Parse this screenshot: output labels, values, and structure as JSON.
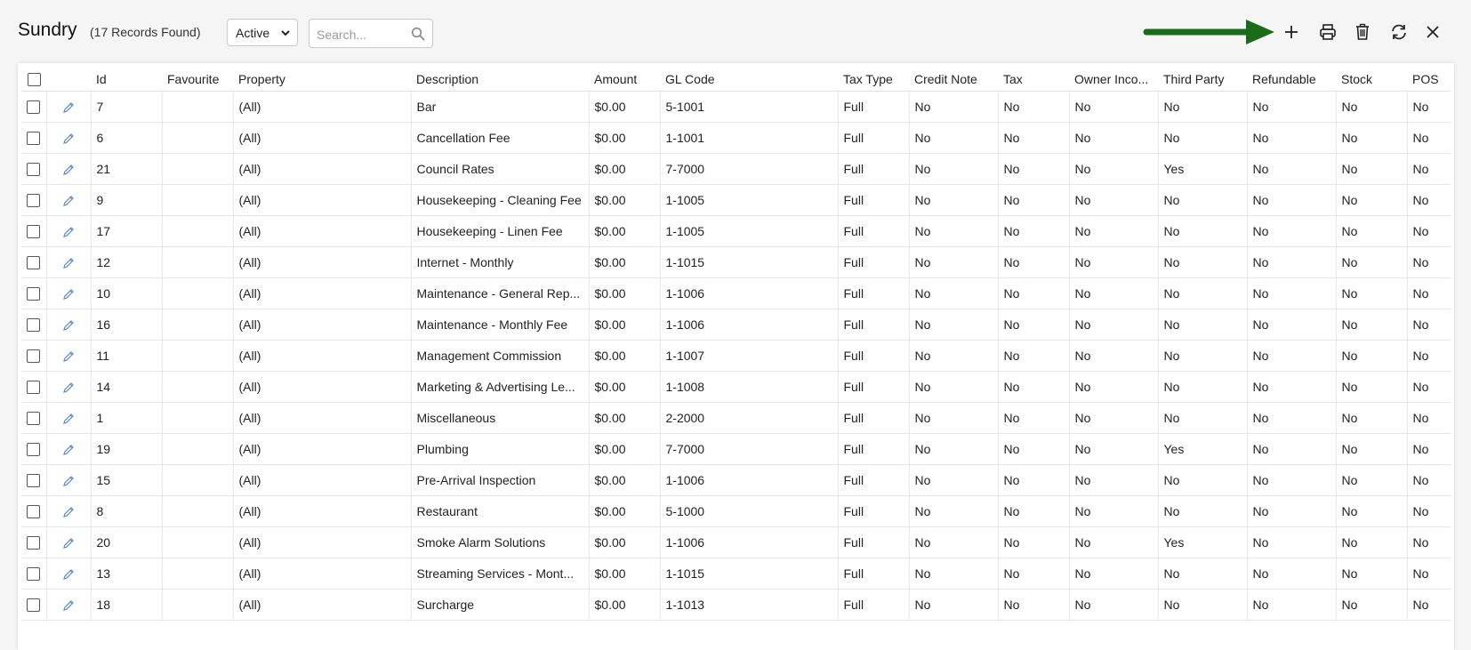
{
  "header": {
    "title": "Sundry",
    "record_count": "(17 Records Found)",
    "status_filter": "Active",
    "search_placeholder": "Search..."
  },
  "toolbar": {
    "add_icon": "plus-icon",
    "print_icon": "printer-icon",
    "delete_icon": "trash-icon",
    "refresh_icon": "refresh-icon",
    "close_icon": "close-icon",
    "arrow_color": "#1a6b1a"
  },
  "table": {
    "columns": [
      "",
      "",
      "Id",
      "Favourite",
      "Property",
      "Description",
      "Amount",
      "GL Code",
      "Tax Type",
      "Credit Note",
      "Tax",
      "Owner Inco...",
      "Third Party",
      "Refundable",
      "Stock",
      "POS"
    ],
    "rows": [
      {
        "id": "7",
        "favourite": "",
        "property": "(All)",
        "description": "Bar",
        "amount": "$0.00",
        "gl_code": "5-1001",
        "tax_type": "Full",
        "credit_note": "No",
        "tax": "No",
        "owner_income": "No",
        "third_party": "No",
        "refundable": "No",
        "stock": "No",
        "pos": "No"
      },
      {
        "id": "6",
        "favourite": "",
        "property": "(All)",
        "description": "Cancellation Fee",
        "amount": "$0.00",
        "gl_code": "1-1001",
        "tax_type": "Full",
        "credit_note": "No",
        "tax": "No",
        "owner_income": "No",
        "third_party": "No",
        "refundable": "No",
        "stock": "No",
        "pos": "No"
      },
      {
        "id": "21",
        "favourite": "",
        "property": "(All)",
        "description": "Council Rates",
        "amount": "$0.00",
        "gl_code": "7-7000",
        "tax_type": "Full",
        "credit_note": "No",
        "tax": "No",
        "owner_income": "No",
        "third_party": "Yes",
        "refundable": "No",
        "stock": "No",
        "pos": "No"
      },
      {
        "id": "9",
        "favourite": "",
        "property": "(All)",
        "description": "Housekeeping - Cleaning Fee",
        "amount": "$0.00",
        "gl_code": "1-1005",
        "tax_type": "Full",
        "credit_note": "No",
        "tax": "No",
        "owner_income": "No",
        "third_party": "No",
        "refundable": "No",
        "stock": "No",
        "pos": "No"
      },
      {
        "id": "17",
        "favourite": "",
        "property": "(All)",
        "description": "Housekeeping - Linen Fee",
        "amount": "$0.00",
        "gl_code": "1-1005",
        "tax_type": "Full",
        "credit_note": "No",
        "tax": "No",
        "owner_income": "No",
        "third_party": "No",
        "refundable": "No",
        "stock": "No",
        "pos": "No"
      },
      {
        "id": "12",
        "favourite": "",
        "property": "(All)",
        "description": "Internet - Monthly",
        "amount": "$0.00",
        "gl_code": "1-1015",
        "tax_type": "Full",
        "credit_note": "No",
        "tax": "No",
        "owner_income": "No",
        "third_party": "No",
        "refundable": "No",
        "stock": "No",
        "pos": "No"
      },
      {
        "id": "10",
        "favourite": "",
        "property": "(All)",
        "description": "Maintenance - General Rep...",
        "amount": "$0.00",
        "gl_code": "1-1006",
        "tax_type": "Full",
        "credit_note": "No",
        "tax": "No",
        "owner_income": "No",
        "third_party": "No",
        "refundable": "No",
        "stock": "No",
        "pos": "No"
      },
      {
        "id": "16",
        "favourite": "",
        "property": "(All)",
        "description": "Maintenance - Monthly Fee",
        "amount": "$0.00",
        "gl_code": "1-1006",
        "tax_type": "Full",
        "credit_note": "No",
        "tax": "No",
        "owner_income": "No",
        "third_party": "No",
        "refundable": "No",
        "stock": "No",
        "pos": "No"
      },
      {
        "id": "11",
        "favourite": "",
        "property": "(All)",
        "description": "Management Commission",
        "amount": "$0.00",
        "gl_code": "1-1007",
        "tax_type": "Full",
        "credit_note": "No",
        "tax": "No",
        "owner_income": "No",
        "third_party": "No",
        "refundable": "No",
        "stock": "No",
        "pos": "No"
      },
      {
        "id": "14",
        "favourite": "",
        "property": "(All)",
        "description": "Marketing & Advertising Le...",
        "amount": "$0.00",
        "gl_code": "1-1008",
        "tax_type": "Full",
        "credit_note": "No",
        "tax": "No",
        "owner_income": "No",
        "third_party": "No",
        "refundable": "No",
        "stock": "No",
        "pos": "No"
      },
      {
        "id": "1",
        "favourite": "",
        "property": "(All)",
        "description": "Miscellaneous",
        "amount": "$0.00",
        "gl_code": "2-2000",
        "tax_type": "Full",
        "credit_note": "No",
        "tax": "No",
        "owner_income": "No",
        "third_party": "No",
        "refundable": "No",
        "stock": "No",
        "pos": "No"
      },
      {
        "id": "19",
        "favourite": "",
        "property": "(All)",
        "description": "Plumbing",
        "amount": "$0.00",
        "gl_code": "7-7000",
        "tax_type": "Full",
        "credit_note": "No",
        "tax": "No",
        "owner_income": "No",
        "third_party": "Yes",
        "refundable": "No",
        "stock": "No",
        "pos": "No"
      },
      {
        "id": "15",
        "favourite": "",
        "property": "(All)",
        "description": "Pre-Arrival Inspection",
        "amount": "$0.00",
        "gl_code": "1-1006",
        "tax_type": "Full",
        "credit_note": "No",
        "tax": "No",
        "owner_income": "No",
        "third_party": "No",
        "refundable": "No",
        "stock": "No",
        "pos": "No"
      },
      {
        "id": "8",
        "favourite": "",
        "property": "(All)",
        "description": "Restaurant",
        "amount": "$0.00",
        "gl_code": "5-1000",
        "tax_type": "Full",
        "credit_note": "No",
        "tax": "No",
        "owner_income": "No",
        "third_party": "No",
        "refundable": "No",
        "stock": "No",
        "pos": "No"
      },
      {
        "id": "20",
        "favourite": "",
        "property": "(All)",
        "description": "Smoke Alarm Solutions",
        "amount": "$0.00",
        "gl_code": "1-1006",
        "tax_type": "Full",
        "credit_note": "No",
        "tax": "No",
        "owner_income": "No",
        "third_party": "Yes",
        "refundable": "No",
        "stock": "No",
        "pos": "No"
      },
      {
        "id": "13",
        "favourite": "",
        "property": "(All)",
        "description": "Streaming Services - Mont...",
        "amount": "$0.00",
        "gl_code": "1-1015",
        "tax_type": "Full",
        "credit_note": "No",
        "tax": "No",
        "owner_income": "No",
        "third_party": "No",
        "refundable": "No",
        "stock": "No",
        "pos": "No"
      },
      {
        "id": "18",
        "favourite": "",
        "property": "(All)",
        "description": "Surcharge",
        "amount": "$0.00",
        "gl_code": "1-1013",
        "tax_type": "Full",
        "credit_note": "No",
        "tax": "No",
        "owner_income": "No",
        "third_party": "No",
        "refundable": "No",
        "stock": "No",
        "pos": "No"
      }
    ]
  }
}
